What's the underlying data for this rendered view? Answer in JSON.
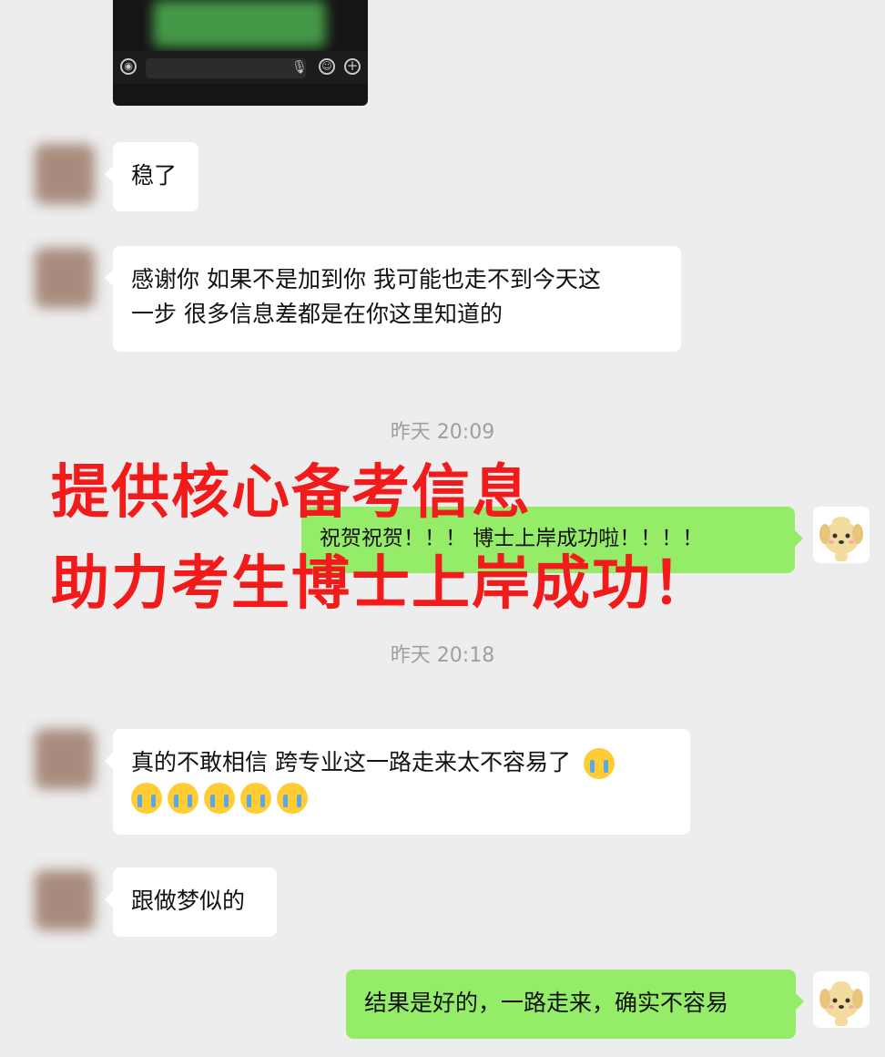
{
  "messages": {
    "m1": "稳了",
    "m2_line1": "感谢你 如果不是加到你 我可能也走不到今天这",
    "m2_line2": "一步 很多信息差都是在你这里知道的",
    "ts1": "昨天 20:09",
    "m3": "祝贺祝贺！！！ 博士上岸成功啦！！！！",
    "ts2": "昨天 20:18",
    "m4_line1": "真的不敢相信 跨专业这一路走来太不容易了",
    "m5": "跟做梦似的",
    "m6": "结果是好的，一路走来，确实不容易"
  },
  "overlay": {
    "line1": "提供核心备考信息",
    "line2": "助力考生博士上岸成功！"
  },
  "emoji": {
    "name": "loudly-crying-face-emoji",
    "count_line1": 1,
    "count_line2": 5
  },
  "colors": {
    "background": "#ededed",
    "self_bubble": "#95ec69",
    "other_bubble": "#ffffff",
    "overlay_text": "#f21b1b",
    "timestamp": "#9f9f9f"
  }
}
